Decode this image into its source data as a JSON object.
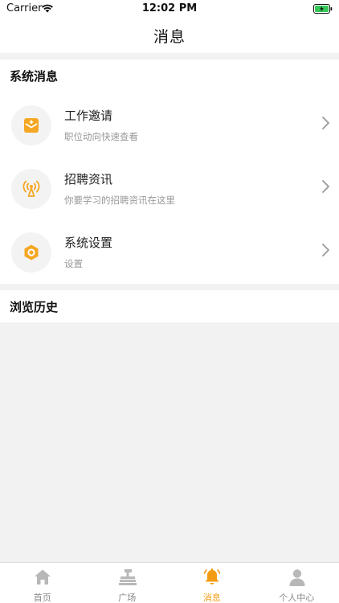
{
  "status_bar": {
    "carrier": "Carrier",
    "time": "12:02 PM"
  },
  "nav": {
    "title": "消息"
  },
  "system_section": {
    "header": "系统消息",
    "items": [
      {
        "title": "工作邀请",
        "subtitle": "职位动向快速查看",
        "icon": "envelope-icon"
      },
      {
        "title": "招聘资讯",
        "subtitle": "你要学习的招聘资讯在这里",
        "icon": "broadcast-antenna-icon"
      },
      {
        "title": "系统设置",
        "subtitle": "设置",
        "icon": "hexagon-settings-icon"
      }
    ]
  },
  "history_section": {
    "header": "浏览历史"
  },
  "tabbar": {
    "active_index": 2,
    "accent_color": "#f39c12",
    "tabs": [
      {
        "label": "首页",
        "icon": "home-icon"
      },
      {
        "label": "广场",
        "icon": "square-icon"
      },
      {
        "label": "消息",
        "icon": "bell-icon"
      },
      {
        "label": "个人中心",
        "icon": "person-icon"
      }
    ]
  }
}
